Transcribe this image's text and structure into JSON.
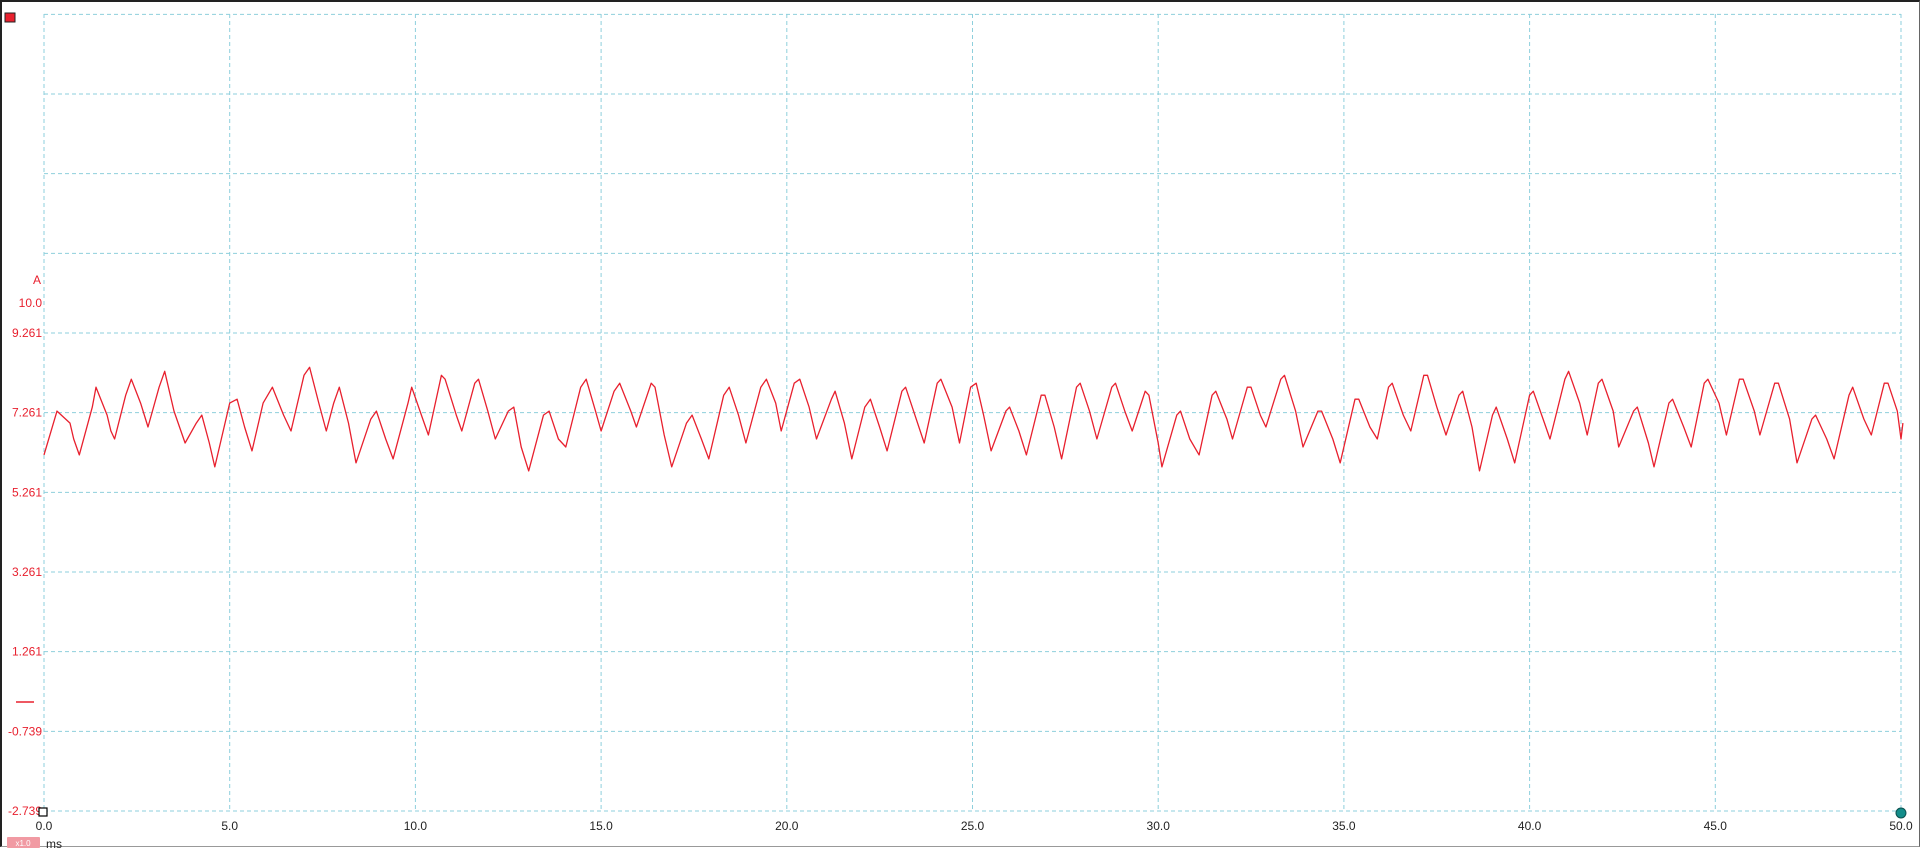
{
  "window": {
    "background": "#ffffff"
  },
  "channel": {
    "name": "A",
    "color": "#e8202e",
    "probe_badge": "x1.0",
    "indicator_icon": "channel-a-indicator-icon",
    "trigger_icon": "trigger-marker-icon",
    "end_marker_icon": "end-marker-icon"
  },
  "grid": {
    "on": true,
    "color": "#8ecfdc",
    "style": "dashed"
  },
  "chart_data": {
    "type": "line",
    "title": "",
    "xlabel": "ms",
    "ylabel": "A",
    "xlim": [
      0.0,
      50.0
    ],
    "ylim": [
      -2.739,
      10.0
    ],
    "x_ticks": [
      "0.0",
      "5.0",
      "10.0",
      "15.0",
      "20.0",
      "25.0",
      "30.0",
      "35.0",
      "40.0",
      "45.0",
      "50.0"
    ],
    "y_ticks": [
      "10.0",
      "9.261",
      "7.261",
      "5.261",
      "3.261",
      "1.261",
      "-0.739",
      "-2.739"
    ],
    "y_tick_values": [
      10.0,
      9.261,
      7.261,
      5.261,
      3.261,
      1.261,
      -0.739,
      -2.739
    ],
    "series": [
      {
        "color": "#e8202e",
        "points": [
          [
            0.0,
            6.2
          ],
          [
            0.35,
            7.3
          ],
          [
            0.7,
            7.0
          ],
          [
            0.8,
            6.6
          ],
          [
            0.95,
            6.2
          ],
          [
            1.3,
            7.4
          ],
          [
            1.4,
            7.9
          ],
          [
            1.7,
            7.2
          ],
          [
            1.8,
            6.8
          ],
          [
            1.9,
            6.6
          ],
          [
            2.2,
            7.7
          ],
          [
            2.35,
            8.1
          ],
          [
            2.6,
            7.5
          ],
          [
            2.8,
            6.9
          ],
          [
            3.1,
            7.9
          ],
          [
            3.25,
            8.3
          ],
          [
            3.5,
            7.3
          ],
          [
            3.8,
            6.5
          ],
          [
            4.1,
            7.0
          ],
          [
            4.25,
            7.2
          ],
          [
            4.45,
            6.5
          ],
          [
            4.6,
            5.9
          ],
          [
            5.0,
            7.5
          ],
          [
            5.2,
            7.6
          ],
          [
            5.4,
            6.9
          ],
          [
            5.6,
            6.3
          ],
          [
            5.9,
            7.5
          ],
          [
            6.15,
            7.9
          ],
          [
            6.45,
            7.2
          ],
          [
            6.65,
            6.8
          ],
          [
            7.0,
            8.2
          ],
          [
            7.15,
            8.4
          ],
          [
            7.4,
            7.5
          ],
          [
            7.6,
            6.8
          ],
          [
            7.8,
            7.5
          ],
          [
            7.95,
            7.9
          ],
          [
            8.2,
            7.0
          ],
          [
            8.4,
            6.0
          ],
          [
            8.8,
            7.1
          ],
          [
            8.95,
            7.3
          ],
          [
            9.2,
            6.6
          ],
          [
            9.4,
            6.1
          ],
          [
            9.8,
            7.5
          ],
          [
            9.9,
            7.9
          ],
          [
            10.2,
            7.1
          ],
          [
            10.35,
            6.7
          ],
          [
            10.7,
            8.2
          ],
          [
            10.8,
            8.1
          ],
          [
            11.1,
            7.2
          ],
          [
            11.25,
            6.8
          ],
          [
            11.6,
            8.0
          ],
          [
            11.7,
            8.1
          ],
          [
            11.95,
            7.3
          ],
          [
            12.15,
            6.6
          ],
          [
            12.5,
            7.3
          ],
          [
            12.65,
            7.4
          ],
          [
            12.85,
            6.4
          ],
          [
            13.05,
            5.8
          ],
          [
            13.45,
            7.2
          ],
          [
            13.6,
            7.3
          ],
          [
            13.85,
            6.6
          ],
          [
            14.05,
            6.4
          ],
          [
            14.45,
            7.9
          ],
          [
            14.6,
            8.1
          ],
          [
            14.85,
            7.3
          ],
          [
            15.0,
            6.8
          ],
          [
            15.35,
            7.8
          ],
          [
            15.5,
            8.0
          ],
          [
            15.8,
            7.3
          ],
          [
            15.95,
            6.9
          ],
          [
            16.35,
            8.0
          ],
          [
            16.45,
            7.9
          ],
          [
            16.7,
            6.7
          ],
          [
            16.9,
            5.9
          ],
          [
            17.3,
            7.0
          ],
          [
            17.45,
            7.2
          ],
          [
            17.7,
            6.6
          ],
          [
            17.9,
            6.1
          ],
          [
            18.3,
            7.7
          ],
          [
            18.45,
            7.9
          ],
          [
            18.7,
            7.2
          ],
          [
            18.9,
            6.5
          ],
          [
            19.3,
            7.9
          ],
          [
            19.45,
            8.1
          ],
          [
            19.7,
            7.5
          ],
          [
            19.85,
            6.8
          ],
          [
            20.2,
            8.0
          ],
          [
            20.35,
            8.1
          ],
          [
            20.6,
            7.4
          ],
          [
            20.8,
            6.6
          ],
          [
            21.2,
            7.6
          ],
          [
            21.3,
            7.8
          ],
          [
            21.55,
            7.0
          ],
          [
            21.75,
            6.1
          ],
          [
            22.1,
            7.4
          ],
          [
            22.25,
            7.6
          ],
          [
            22.5,
            6.9
          ],
          [
            22.7,
            6.3
          ],
          [
            23.1,
            7.8
          ],
          [
            23.2,
            7.9
          ],
          [
            23.45,
            7.2
          ],
          [
            23.7,
            6.5
          ],
          [
            24.05,
            8.0
          ],
          [
            24.15,
            8.1
          ],
          [
            24.45,
            7.4
          ],
          [
            24.65,
            6.5
          ],
          [
            24.95,
            7.9
          ],
          [
            25.1,
            8.0
          ],
          [
            25.3,
            7.2
          ],
          [
            25.5,
            6.3
          ],
          [
            25.9,
            7.3
          ],
          [
            26.0,
            7.4
          ],
          [
            26.25,
            6.8
          ],
          [
            26.45,
            6.2
          ],
          [
            26.85,
            7.7
          ],
          [
            26.95,
            7.7
          ],
          [
            27.2,
            6.9
          ],
          [
            27.4,
            6.1
          ],
          [
            27.8,
            7.9
          ],
          [
            27.9,
            8.0
          ],
          [
            28.15,
            7.3
          ],
          [
            28.35,
            6.6
          ],
          [
            28.75,
            7.9
          ],
          [
            28.85,
            8.0
          ],
          [
            29.1,
            7.3
          ],
          [
            29.3,
            6.8
          ],
          [
            29.65,
            7.8
          ],
          [
            29.75,
            7.7
          ],
          [
            30.0,
            6.5
          ],
          [
            30.1,
            5.9
          ],
          [
            30.5,
            7.2
          ],
          [
            30.6,
            7.3
          ],
          [
            30.85,
            6.6
          ],
          [
            31.1,
            6.2
          ],
          [
            31.45,
            7.7
          ],
          [
            31.55,
            7.8
          ],
          [
            31.85,
            7.1
          ],
          [
            32.0,
            6.6
          ],
          [
            32.4,
            7.9
          ],
          [
            32.5,
            7.9
          ],
          [
            32.75,
            7.2
          ],
          [
            32.9,
            6.9
          ],
          [
            33.3,
            8.1
          ],
          [
            33.4,
            8.2
          ],
          [
            33.7,
            7.3
          ],
          [
            33.9,
            6.4
          ],
          [
            34.3,
            7.3
          ],
          [
            34.4,
            7.3
          ],
          [
            34.7,
            6.6
          ],
          [
            34.9,
            6.0
          ],
          [
            35.3,
            7.6
          ],
          [
            35.4,
            7.6
          ],
          [
            35.7,
            6.9
          ],
          [
            35.9,
            6.6
          ],
          [
            36.2,
            7.9
          ],
          [
            36.3,
            8.0
          ],
          [
            36.6,
            7.2
          ],
          [
            36.8,
            6.8
          ],
          [
            37.15,
            8.2
          ],
          [
            37.25,
            8.2
          ],
          [
            37.5,
            7.4
          ],
          [
            37.75,
            6.7
          ],
          [
            38.1,
            7.7
          ],
          [
            38.2,
            7.8
          ],
          [
            38.45,
            6.9
          ],
          [
            38.65,
            5.8
          ],
          [
            39.0,
            7.2
          ],
          [
            39.1,
            7.4
          ],
          [
            39.4,
            6.6
          ],
          [
            39.6,
            6.0
          ],
          [
            40.0,
            7.7
          ],
          [
            40.1,
            7.8
          ],
          [
            40.4,
            7.0
          ],
          [
            40.55,
            6.6
          ],
          [
            40.95,
            8.1
          ],
          [
            41.05,
            8.3
          ],
          [
            41.35,
            7.5
          ],
          [
            41.55,
            6.7
          ],
          [
            41.85,
            8.0
          ],
          [
            41.95,
            8.1
          ],
          [
            42.25,
            7.3
          ],
          [
            42.4,
            6.4
          ],
          [
            42.8,
            7.3
          ],
          [
            42.9,
            7.4
          ],
          [
            43.2,
            6.5
          ],
          [
            43.35,
            5.9
          ],
          [
            43.75,
            7.5
          ],
          [
            43.85,
            7.6
          ],
          [
            44.15,
            6.9
          ],
          [
            44.35,
            6.4
          ],
          [
            44.7,
            8.0
          ],
          [
            44.8,
            8.1
          ],
          [
            45.1,
            7.5
          ],
          [
            45.3,
            6.7
          ],
          [
            45.65,
            8.1
          ],
          [
            45.75,
            8.1
          ],
          [
            46.05,
            7.3
          ],
          [
            46.2,
            6.7
          ],
          [
            46.6,
            8.0
          ],
          [
            46.7,
            8.0
          ],
          [
            47.0,
            7.1
          ],
          [
            47.2,
            6.0
          ],
          [
            47.6,
            7.1
          ],
          [
            47.7,
            7.2
          ],
          [
            48.0,
            6.6
          ],
          [
            48.2,
            6.1
          ],
          [
            48.6,
            7.7
          ],
          [
            48.7,
            7.9
          ],
          [
            49.0,
            7.1
          ],
          [
            49.2,
            6.7
          ],
          [
            49.55,
            8.0
          ],
          [
            49.65,
            8.0
          ],
          [
            49.9,
            7.3
          ],
          [
            50.0,
            6.6
          ],
          [
            50.05,
            7.0
          ]
        ]
      }
    ]
  }
}
